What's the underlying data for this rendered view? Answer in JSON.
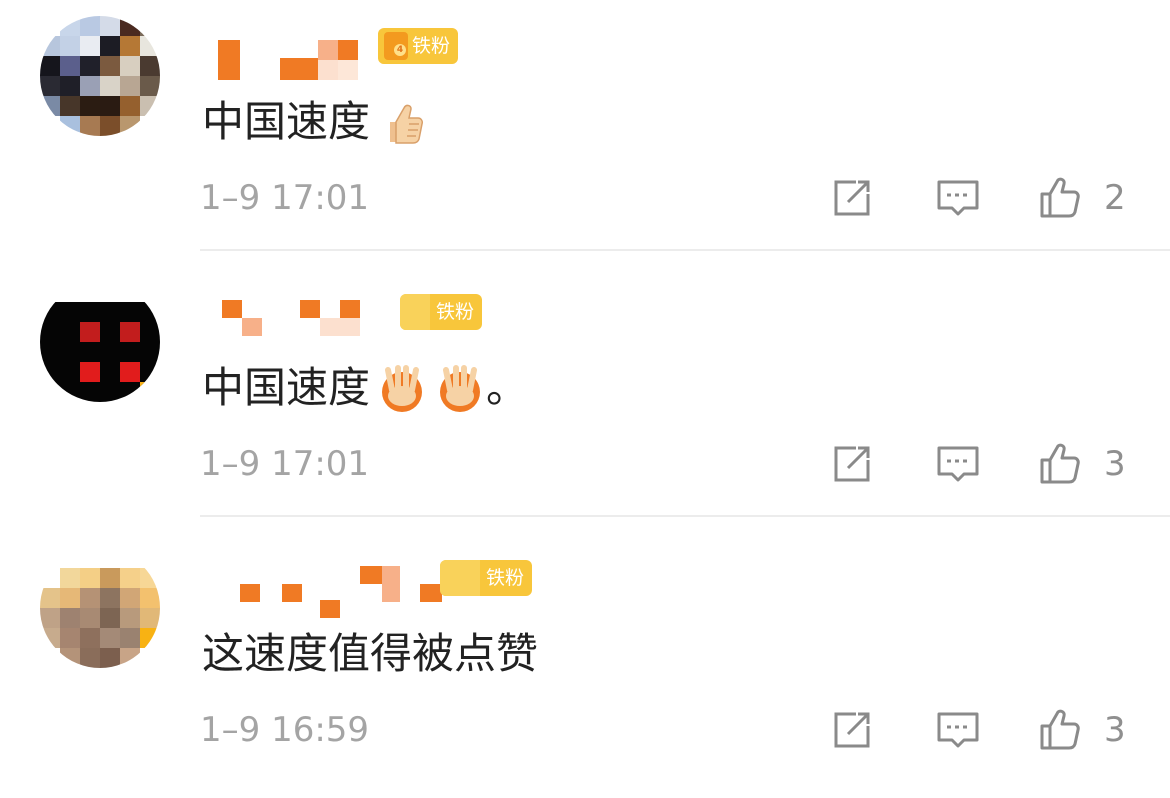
{
  "comments": [
    {
      "badge": "铁粉",
      "badge_level": "4",
      "text": "中国速度",
      "emoji": "thumbs-up-emoji",
      "time": "1–9 17:01",
      "likes": "2"
    },
    {
      "badge": "铁粉",
      "text": "中国速度",
      "emoji": "victory-hands-emoji",
      "suffix": "。",
      "time": "1–9 17:01",
      "likes": "3"
    },
    {
      "badge": "铁粉",
      "text": "这速度值得被点赞",
      "time": "1–9 16:59",
      "likes": "3"
    }
  ],
  "icons": {
    "share": "share-icon",
    "reply": "comment-icon",
    "like": "like-icon"
  },
  "colors": {
    "badge": "#f8c63b",
    "name_mosaic": "#f07a24",
    "timestamp": "#a4a4a4",
    "text": "#222222"
  }
}
